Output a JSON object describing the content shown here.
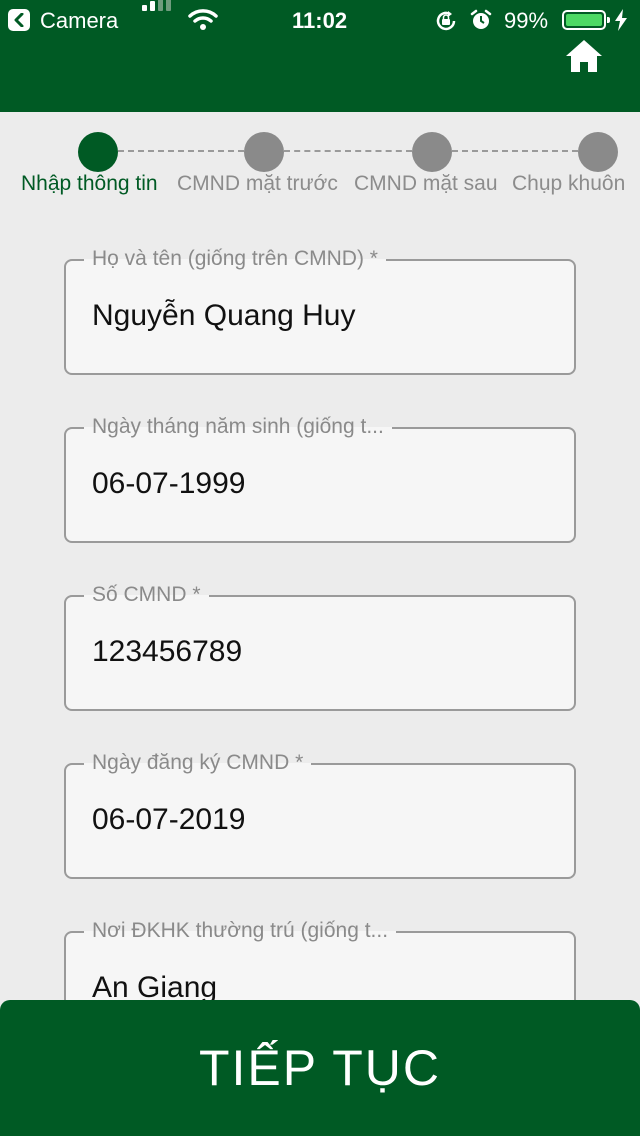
{
  "status_bar": {
    "back_app": "Camera",
    "time": "11:02",
    "battery_percent": "99%",
    "battery_level": 0.99,
    "icons": [
      "back-arrow-icon",
      "signal-icon",
      "wifi-icon",
      "rotation-lock-icon",
      "alarm-icon",
      "battery-icon",
      "charging-bolt-icon"
    ]
  },
  "header": {
    "home_icon": "home-icon",
    "color": "#005a24"
  },
  "stepper": {
    "active_index": 0,
    "steps": [
      {
        "label": "Nhập thông tin"
      },
      {
        "label": "CMND mặt trước"
      },
      {
        "label": "CMND mặt sau"
      },
      {
        "label": "Chụp khuôn"
      }
    ]
  },
  "form": {
    "fields": [
      {
        "label": "Họ và tên (giống trên CMND) *",
        "value": "Nguyễn Quang Huy"
      },
      {
        "label": "Ngày tháng năm sinh (giống t...",
        "value": "06-07-1999"
      },
      {
        "label": "Số CMND *",
        "value": "123456789"
      },
      {
        "label": "Ngày đăng ký CMND *",
        "value": "06-07-2019"
      },
      {
        "label": "Nơi ĐKHK thường trú (giống t...",
        "value": "An Giang"
      }
    ]
  },
  "continue_button": {
    "label": "TIẾP TỤC"
  },
  "colors": {
    "primary": "#005a24",
    "inactive": "#8a8a8a",
    "background": "#ececec"
  }
}
